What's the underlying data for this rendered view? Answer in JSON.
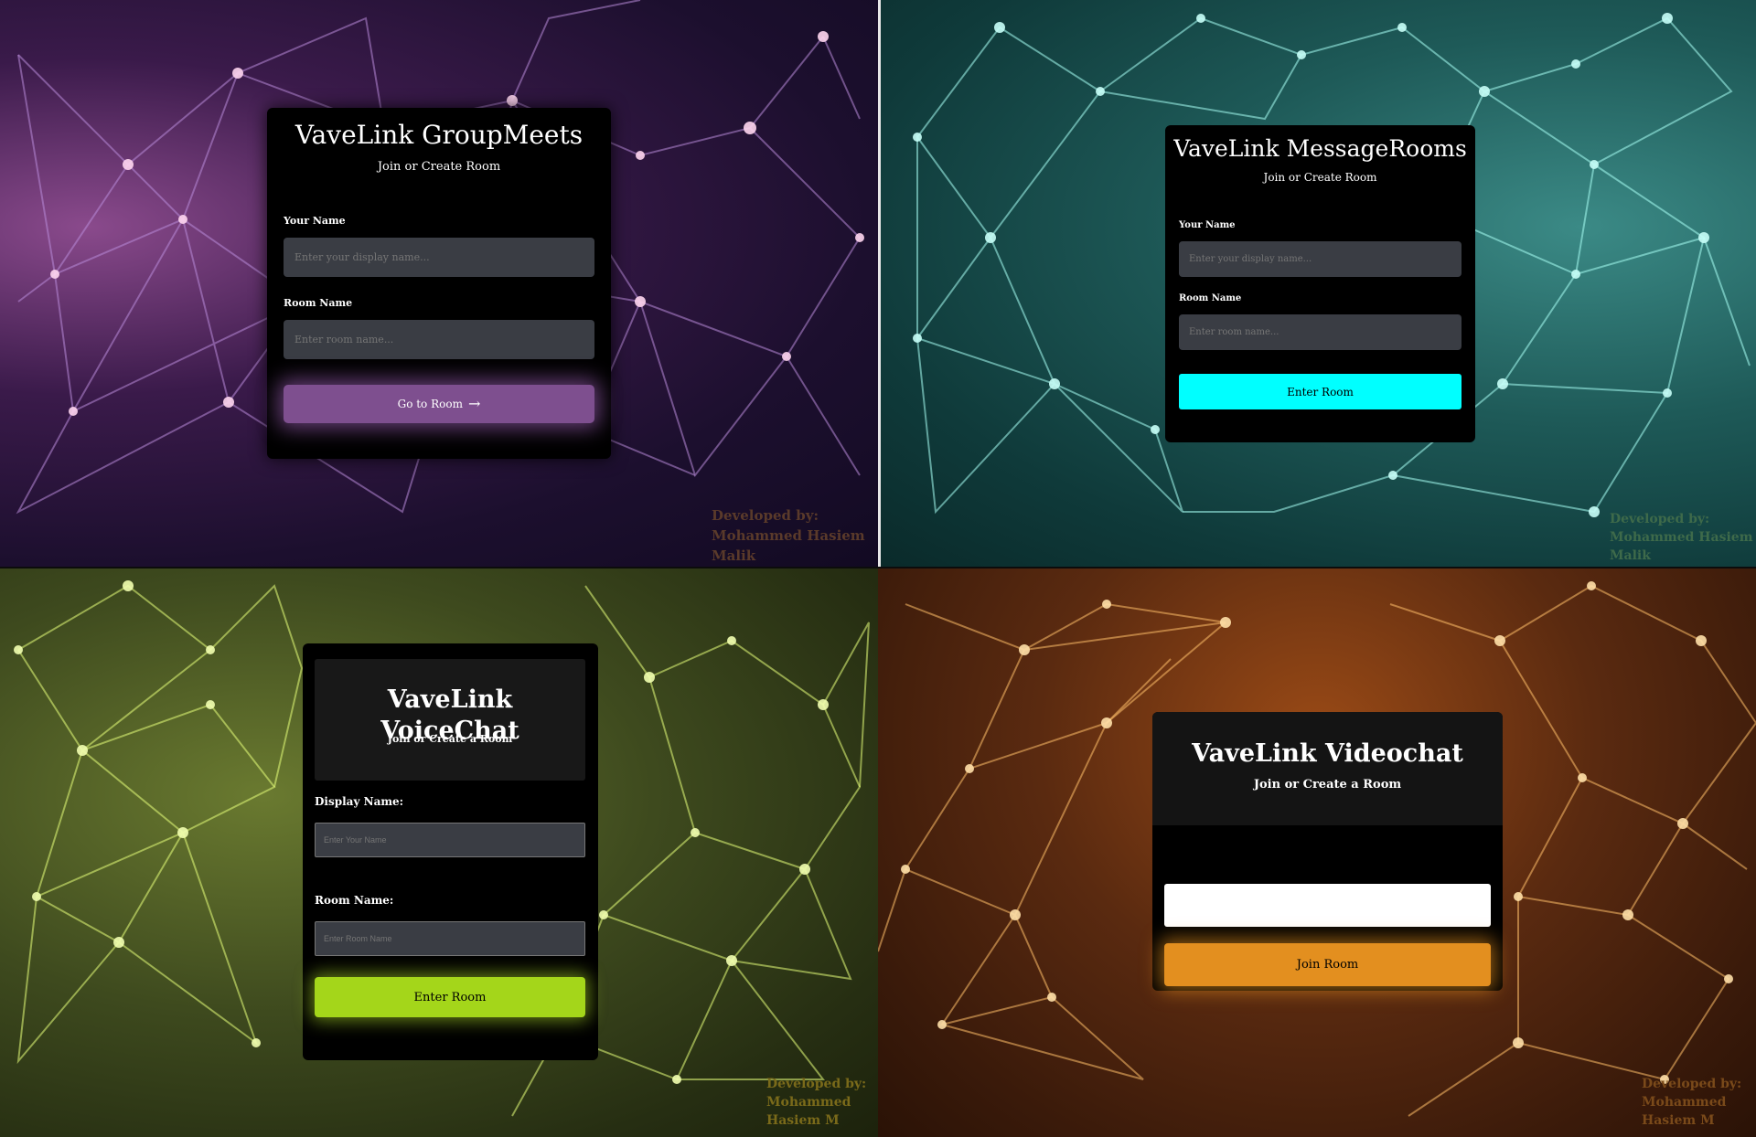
{
  "panels": [
    {
      "title": "VaveLink GroupMeets",
      "subtitle": "Join or Create Room",
      "name_label": "Your Name",
      "name_placeholder": "Enter your display name...",
      "room_label": "Room Name",
      "room_placeholder": "Enter room name...",
      "button_label": "Go to Room",
      "button_icon": "arrow-right-icon",
      "accent": "#7e4f8f",
      "credit_line1": "Developed by:",
      "credit_line2": "Mohammed Hasiem Malik"
    },
    {
      "title": "VaveLink MessageRooms",
      "subtitle": "Join or Create Room",
      "name_label": "Your Name",
      "name_placeholder": "Enter your display name...",
      "room_label": "Room Name",
      "room_placeholder": "Enter room name...",
      "button_label": "Enter Room",
      "accent": "#00ffff",
      "credit_line1": "Developed by:",
      "credit_line2": "Mohammed Hasiem Malik"
    },
    {
      "title": "VaveLink VoiceChat",
      "subtitle": "Join or Create a Room",
      "name_label": "Display Name:",
      "name_placeholder": "Enter Your Name",
      "room_label": "Room Name:",
      "room_placeholder": "Enter Room Name",
      "button_label": "Enter Room",
      "accent": "#a4d61a",
      "credit_line1": "Developed by:",
      "credit_line2": "Mohammed Hasiem M"
    },
    {
      "title": "VaveLink Videochat",
      "subtitle": "Join or Create a Room",
      "input_value": "",
      "button_label": "Join Room",
      "accent": "#e38f1f",
      "credit_line1": "Developed by:",
      "credit_line2": "Mohammed Hasiem M"
    }
  ]
}
